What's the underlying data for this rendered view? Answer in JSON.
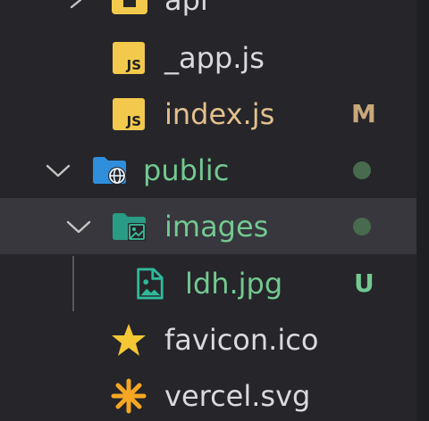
{
  "colors": {
    "panel_bg": "#25252a",
    "selected_bg": "#37373d",
    "default_text": "#d9dadc",
    "modified_text": "#e3c08d",
    "untracked_text": "#73c991",
    "dot_color": "#486a4e",
    "js_badge": "#f2c94c",
    "folder_blue": "#2f8fdc",
    "folder_teal": "#2a9b84",
    "star": "#f5c735",
    "vercel": "#f5a623"
  },
  "tree": {
    "api": {
      "label": "api",
      "icon": "api-folder-icon"
    },
    "app_js": {
      "label": "_app.js",
      "icon": "js-file-icon"
    },
    "index_js": {
      "label": "index.js",
      "icon": "js-file-icon",
      "status": "M"
    },
    "public": {
      "label": "public",
      "icon": "public-folder-icon"
    },
    "images": {
      "label": "images",
      "icon": "images-folder-icon"
    },
    "ldh_jpg": {
      "label": "ldh.jpg",
      "icon": "image-file-icon",
      "status": "U"
    },
    "favicon": {
      "label": "favicon.ico",
      "icon": "star-icon"
    },
    "vercel": {
      "label": "vercel.svg",
      "icon": "vercel-asterisk-icon"
    }
  },
  "js_badge_text": "JS"
}
